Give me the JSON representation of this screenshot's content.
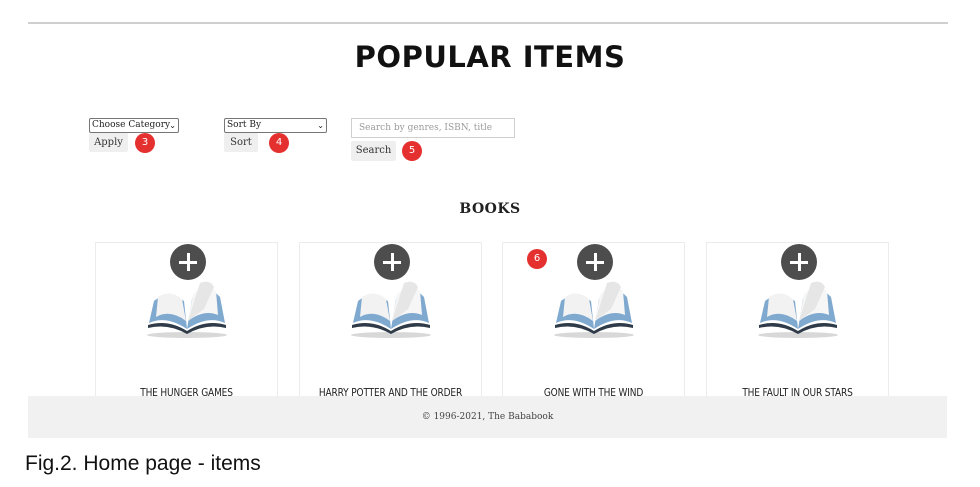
{
  "page_title": "POPULAR ITEMS",
  "filters": {
    "category": {
      "selected": "Choose Category",
      "button": "Apply",
      "badge": "3"
    },
    "sort": {
      "selected": "Sort By",
      "button": "Sort",
      "badge": "4"
    },
    "search": {
      "placeholder": "Search by genres, ISBN, title",
      "button": "Search",
      "badge": "5"
    }
  },
  "section_title": "BOOKS",
  "card_badge": "6",
  "books": [
    {
      "title": "THE HUNGER GAMES"
    },
    {
      "title": "HARRY POTTER AND THE ORDER"
    },
    {
      "title": "GONE WITH THE WIND"
    },
    {
      "title": "THE FAULT IN OUR STARS"
    }
  ],
  "footer": "© 1996-2021, The Bababook",
  "caption": "Fig.2. Home page - items",
  "icons": {
    "add": "plus-icon",
    "book": "open-book-icon",
    "dropdown": "chevron-down-icon"
  },
  "colors": {
    "badge": "#e53030",
    "add_button": "#4d4d4d",
    "footer_bg": "#f1f1f1"
  }
}
